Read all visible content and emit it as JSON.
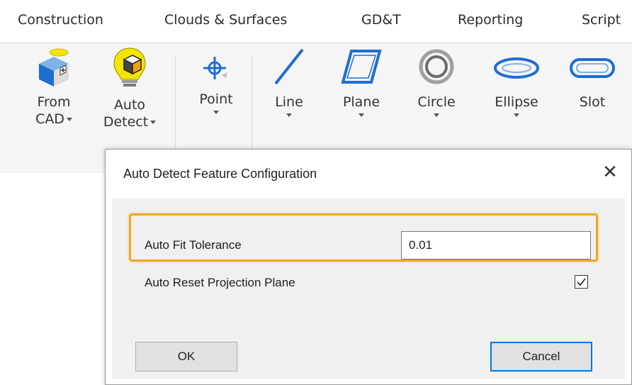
{
  "tabs": [
    "Construction",
    "Clouds & Surfaces",
    "GD&T",
    "Reporting",
    "Script"
  ],
  "ribbon": {
    "buttons": [
      {
        "line1": "From",
        "line2": "CAD",
        "icon": "from-cad-icon"
      },
      {
        "line1": "Auto",
        "line2": "Detect",
        "icon": "auto-detect-icon"
      },
      {
        "line1": "Point",
        "line2": "",
        "icon": "point-icon"
      },
      {
        "line1": "Line",
        "line2": "",
        "icon": "line-icon"
      },
      {
        "line1": "Plane",
        "line2": "",
        "icon": "plane-icon"
      },
      {
        "line1": "Circle",
        "line2": "",
        "icon": "circle-icon"
      },
      {
        "line1": "Ellipse",
        "line2": "",
        "icon": "ellipse-icon"
      },
      {
        "line1": "Slot",
        "line2": "",
        "icon": "slot-icon"
      }
    ]
  },
  "dialog": {
    "title": "Auto Detect Feature Configuration",
    "close_glyph": "✕",
    "fields": {
      "tolerance_label": "Auto Fit Tolerance",
      "tolerance_value": "0.01",
      "reset_label": "Auto Reset Projection Plane",
      "reset_checked": true
    },
    "ok_label": "OK",
    "cancel_label": "Cancel"
  },
  "colors": {
    "highlight": "#f0a628",
    "icon_blue": "#1e6ecf",
    "bulb_yellow": "#f5e400",
    "focus_border": "#0078d7"
  }
}
